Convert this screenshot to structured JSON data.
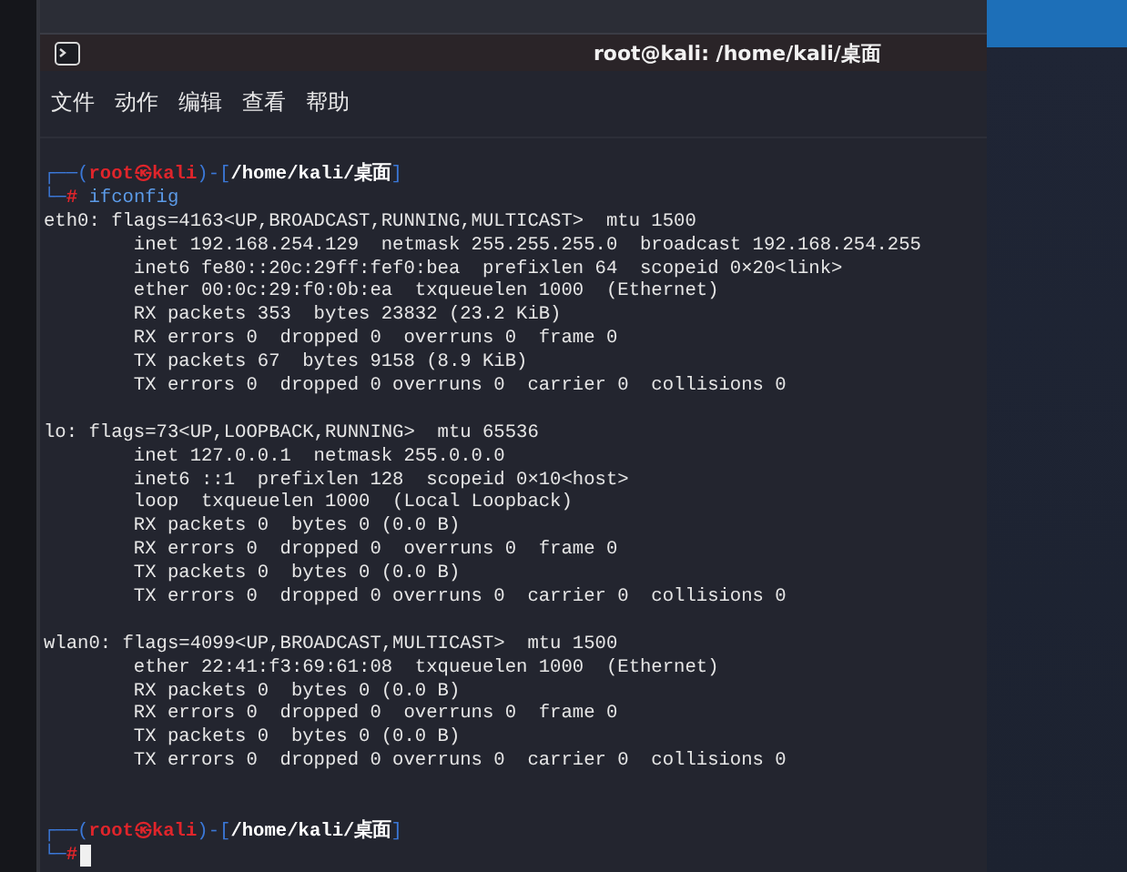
{
  "window": {
    "title": "root@kali: /home/kali/桌面"
  },
  "menu": [
    "文件",
    "动作",
    "编辑",
    "查看",
    "帮助"
  ],
  "terminal": [
    {
      "kind": "prompt",
      "top": "┌──(",
      "user": "root",
      "at": "㉿",
      "host": "kali",
      "mid": ")-[",
      "path": "/home/kali/桌面",
      "close": "]",
      "bottom": "└─",
      "hash": "#",
      "command": "ifconfig",
      "cursor": false
    },
    {
      "kind": "output",
      "text": "eth0: flags=4163<UP,BROADCAST,RUNNING,MULTICAST>  mtu 1500"
    },
    {
      "kind": "output",
      "text": "        inet 192.168.254.129  netmask 255.255.255.0  broadcast 192.168.254.255"
    },
    {
      "kind": "output",
      "text": "        inet6 fe80::20c:29ff:fef0:bea  prefixlen 64  scopeid 0×20<link>"
    },
    {
      "kind": "output",
      "text": "        ether 00:0c:29:f0:0b:ea  txqueuelen 1000  (Ethernet)"
    },
    {
      "kind": "output",
      "text": "        RX packets 353  bytes 23832 (23.2 KiB)"
    },
    {
      "kind": "output",
      "text": "        RX errors 0  dropped 0  overruns 0  frame 0"
    },
    {
      "kind": "output",
      "text": "        TX packets 67  bytes 9158 (8.9 KiB)"
    },
    {
      "kind": "output",
      "text": "        TX errors 0  dropped 0 overruns 0  carrier 0  collisions 0"
    },
    {
      "kind": "blank"
    },
    {
      "kind": "output",
      "text": "lo: flags=73<UP,LOOPBACK,RUNNING>  mtu 65536"
    },
    {
      "kind": "output",
      "text": "        inet 127.0.0.1  netmask 255.0.0.0"
    },
    {
      "kind": "output",
      "text": "        inet6 ::1  prefixlen 128  scopeid 0×10<host>"
    },
    {
      "kind": "output",
      "text": "        loop  txqueuelen 1000  (Local Loopback)"
    },
    {
      "kind": "output",
      "text": "        RX packets 0  bytes 0 (0.0 B)"
    },
    {
      "kind": "output",
      "text": "        RX errors 0  dropped 0  overruns 0  frame 0"
    },
    {
      "kind": "output",
      "text": "        TX packets 0  bytes 0 (0.0 B)"
    },
    {
      "kind": "output",
      "text": "        TX errors 0  dropped 0 overruns 0  carrier 0  collisions 0"
    },
    {
      "kind": "blank"
    },
    {
      "kind": "output",
      "text": "wlan0: flags=4099<UP,BROADCAST,MULTICAST>  mtu 1500"
    },
    {
      "kind": "output",
      "text": "        ether 22:41:f3:69:61:08  txqueuelen 1000  (Ethernet)"
    },
    {
      "kind": "output",
      "text": "        RX packets 0  bytes 0 (0.0 B)"
    },
    {
      "kind": "output",
      "text": "        RX errors 0  dropped 0  overruns 0  frame 0"
    },
    {
      "kind": "output",
      "text": "        TX packets 0  bytes 0 (0.0 B)"
    },
    {
      "kind": "output",
      "text": "        TX errors 0  dropped 0 overruns 0  carrier 0  collisions 0"
    },
    {
      "kind": "blank"
    },
    {
      "kind": "blank"
    },
    {
      "kind": "prompt",
      "top": "┌──(",
      "user": "root",
      "at": "㉿",
      "host": "kali",
      "mid": ")-[",
      "path": "/home/kali/桌面",
      "close": "]",
      "bottom": "└─",
      "hash": "#",
      "cursor": true
    }
  ]
}
